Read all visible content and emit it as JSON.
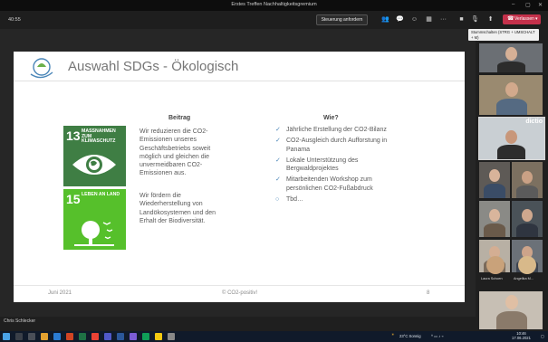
{
  "window": {
    "title": "Erstes Treffen Nachhaltigkeitsgremium"
  },
  "toolbar": {
    "timer": "40:55",
    "control_button": "Steuerung anfordern",
    "leave_button": "Verlassen",
    "tooltip": "Stummschalten (STRG + UMSCHALT + M)"
  },
  "slide": {
    "title": "Auswahl SDGs - Ökologisch",
    "sdg13": {
      "number": "13",
      "label": "MASSNAHMEN ZUM KLIMASCHUTZ"
    },
    "sdg15": {
      "number": "15",
      "label": "LEBEN AN LAND"
    },
    "beitrag_heading": "Beitrag",
    "beitrag_paragraphs": [
      "Wir reduzieren die CO2-Emissionen unseres Geschäftsbetriebs soweit möglich und gleichen die unvermeidbaren CO2-Emissionen aus.",
      "Wir fördern die Wiederherstellung von Landökosystemen und den Erhalt der Biodiversität."
    ],
    "wie_heading": "Wie?",
    "wie_items": [
      {
        "marker": "✓",
        "text": "Jährliche Erstellung der CO2-Bilanz"
      },
      {
        "marker": "✓",
        "text": "CO2-Ausgleich durch Aufforstung in Panama"
      },
      {
        "marker": "✓",
        "text": "Lokale Unterstützung des Bergwaldprojektes"
      },
      {
        "marker": "✓",
        "text": "Mitarbeitenden Workshop zum persönlichen CO2-Fußabdruck"
      },
      {
        "marker": "○",
        "text": "Tbd…"
      }
    ],
    "footer": {
      "date": "Juni 2021",
      "copyright": "© CO2-positiv!",
      "page": "8"
    }
  },
  "presenter_label": "Chris Schlecker",
  "participants": {
    "dictio_label": "dictio",
    "named": [
      {
        "name": "Laura Schoen",
        "color": "#c9a27a"
      },
      {
        "name": "Angelika M...",
        "color": "#d8b98a"
      }
    ]
  },
  "taskbar": {
    "weather": "23°C Sonnig",
    "time": "10:46",
    "date": "17.06.2021"
  },
  "colors": {
    "leave_red": "#c4314b",
    "sdg13_green": "#3f7e44",
    "sdg15_green": "#56c02b",
    "check_blue": "#4a86b8"
  }
}
